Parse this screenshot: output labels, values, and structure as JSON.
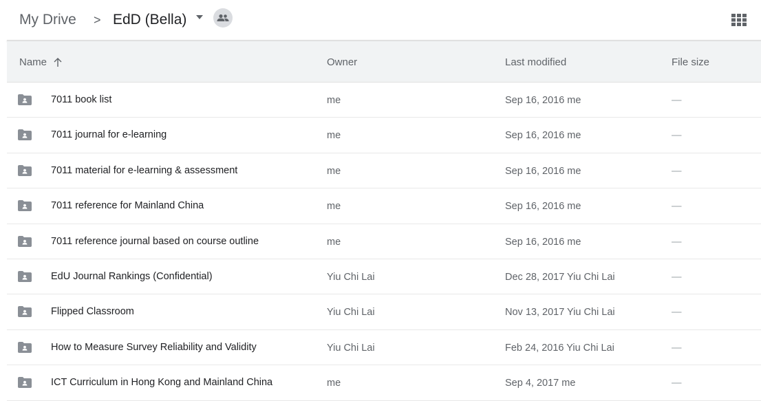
{
  "breadcrumb": {
    "root": "My Drive",
    "separator": ">",
    "current": "EdD (Bella)"
  },
  "icons": {
    "caret": "caret-down-icon",
    "shared": "people-icon",
    "view_toggle": "grid-view-icon",
    "sort": "arrow-up-icon",
    "folder": "shared-folder-icon"
  },
  "colors": {
    "header_bg": "#f1f3f4",
    "folder": "#8a8f96",
    "text": "#202124",
    "muted": "#5f6368"
  },
  "table": {
    "columns": {
      "name": "Name",
      "owner": "Owner",
      "last_modified": "Last modified",
      "file_size": "File size"
    },
    "rows": [
      {
        "name": "7011 book list",
        "owner": "me",
        "modified": "Sep 16, 2016 me",
        "size": "—"
      },
      {
        "name": "7011 journal for e-learning",
        "owner": "me",
        "modified": "Sep 16, 2016 me",
        "size": "—"
      },
      {
        "name": "7011 material for e-learning & assessment",
        "owner": "me",
        "modified": "Sep 16, 2016 me",
        "size": "—"
      },
      {
        "name": "7011 reference for Mainland China",
        "owner": "me",
        "modified": "Sep 16, 2016 me",
        "size": "—"
      },
      {
        "name": "7011 reference journal based on course outline",
        "owner": "me",
        "modified": "Sep 16, 2016 me",
        "size": "—"
      },
      {
        "name": "EdU Journal Rankings (Confidential)",
        "owner": "Yiu Chi Lai",
        "modified": "Dec 28, 2017 Yiu Chi Lai",
        "size": "—"
      },
      {
        "name": "Flipped Classroom",
        "owner": "Yiu Chi Lai",
        "modified": "Nov 13, 2017 Yiu Chi Lai",
        "size": "—"
      },
      {
        "name": "How to Measure Survey Reliability and Validity",
        "owner": "Yiu Chi Lai",
        "modified": "Feb 24, 2016 Yiu Chi Lai",
        "size": "—"
      },
      {
        "name": "ICT Curriculum in Hong Kong and Mainland China",
        "owner": "me",
        "modified": "Sep 4, 2017 me",
        "size": "—"
      }
    ]
  }
}
